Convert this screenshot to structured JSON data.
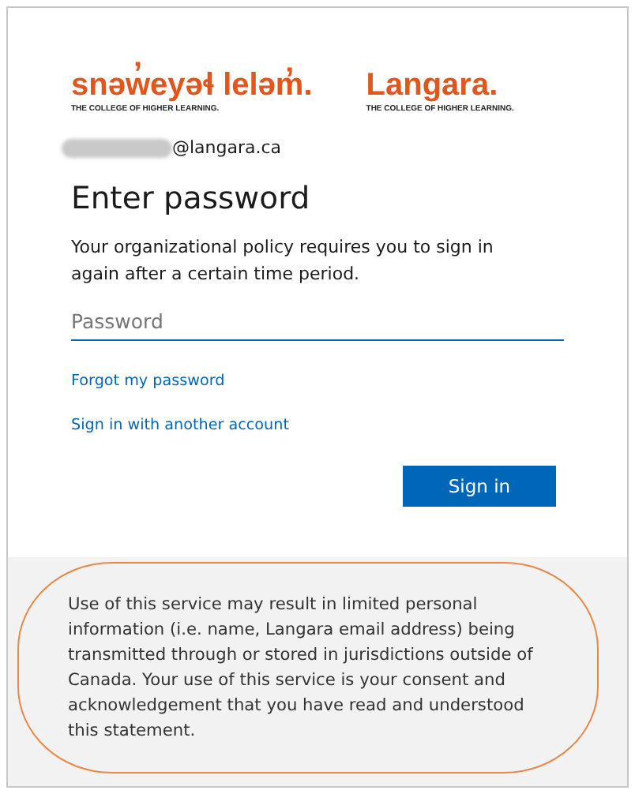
{
  "logos": [
    {
      "name": "snəw̓eyəɬ leləm̓.",
      "tagline": "THE COLLEGE OF HIGHER LEARNING."
    },
    {
      "name": "Langara.",
      "tagline": "THE COLLEGE OF HIGHER LEARNING."
    }
  ],
  "account": {
    "domain": "@langara.ca"
  },
  "title": "Enter password",
  "message": "Your organizational policy requires you to sign in again after a certain time period.",
  "password": {
    "placeholder": "Password"
  },
  "links": [
    "Forgot my password",
    "Sign in with another account"
  ],
  "button": "Sign in",
  "footer": "Use of this service may result in limited personal information (i.e. name, Langara email address) being transmitted through or stored in jurisdictions outside of Canada. Your use of this service is your consent and acknowledgement that you have read and understood this statement."
}
